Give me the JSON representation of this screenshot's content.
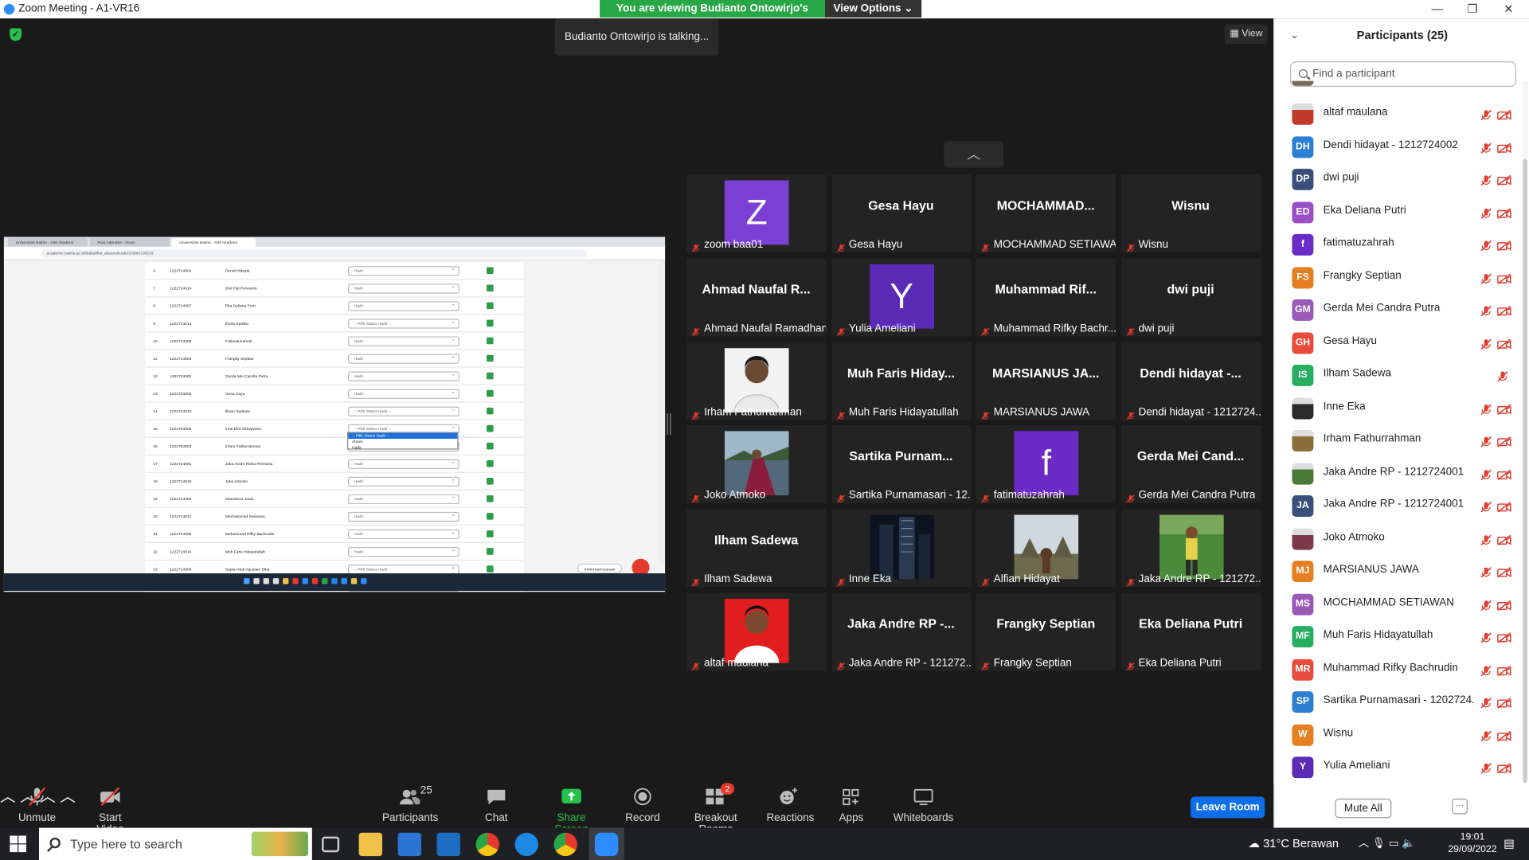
{
  "window": {
    "title": "Zoom Meeting - A1-VR16",
    "minimize": "—",
    "restore": "❐",
    "close": "✕"
  },
  "share_banner": {
    "text": "You are viewing Budianto Ontowirjo's screen",
    "view_options": "View Options ⌄"
  },
  "talking_indicator": "Budianto Ontowirjo is talking...",
  "view_button": "View",
  "gallery": [
    {
      "big": "",
      "avatar_letter": "Z",
      "avatar_color": "#7b3fd4",
      "name": "zoom baa01"
    },
    {
      "big": "Gesa Hayu",
      "name": "Gesa Hayu"
    },
    {
      "big": "MOCHAMMAD...",
      "name": "MOCHAMMAD SETIAWA..."
    },
    {
      "big": "Wisnu",
      "name": "Wisnu"
    },
    {
      "big": "Ahmad Naufal R...",
      "name": "Ahmad Naufal Ramadhan"
    },
    {
      "big": "",
      "avatar_letter": "Y",
      "avatar_color": "#5b2bb8",
      "name": "Yulia Ameliani"
    },
    {
      "big": "Muhammad Rif...",
      "name": "Muhammad Rifky Bachr..."
    },
    {
      "big": "dwi puji",
      "name": "dwi puji"
    },
    {
      "big": "",
      "photo": "person-white",
      "name": "Irham Fathurrahman"
    },
    {
      "big": "Muh Faris Hiday...",
      "name": "Muh Faris Hidayatullah"
    },
    {
      "big": "MARSIANUS JA...",
      "name": "MARSIANUS JAWA"
    },
    {
      "big": "Dendi hidayat -...",
      "name": "Dendi hidayat - 1212724..."
    },
    {
      "big": "",
      "photo": "landscape-scarf",
      "name": "Joko Atmoko"
    },
    {
      "big": "Sartika Purnam...",
      "name": "Sartika Purnamasari - 12..."
    },
    {
      "big": "",
      "avatar_letter": "f",
      "avatar_color": "#6a2bc7",
      "name": "fatimatuzahrah"
    },
    {
      "big": "Gerda Mei Cand...",
      "name": "Gerda Mei Candra Putra"
    },
    {
      "big": "Ilham Sadewa",
      "name": "Ilham Sadewa"
    },
    {
      "big": "",
      "photo": "city-night",
      "name": "Inne Eka"
    },
    {
      "big": "",
      "photo": "temple",
      "name": "Alfian Hidayat"
    },
    {
      "big": "",
      "photo": "football",
      "name": "Jaka Andre RP - 121272..."
    },
    {
      "big": "",
      "photo": "person-red",
      "name": "altaf maulana"
    },
    {
      "big": "Jaka Andre RP -...",
      "name": "Jaka Andre RP - 121272..."
    },
    {
      "big": "Frangky Septian",
      "name": "Frangky Septian"
    },
    {
      "big": "Eka Deliana Putri",
      "name": "Eka Deliana Putri"
    }
  ],
  "participants": {
    "title": "Participants (25)",
    "search_placeholder": "Find a participant",
    "list": [
      {
        "initials": "",
        "color": "#c0392b",
        "photo": true,
        "name": "altaf maulana",
        "cam": true
      },
      {
        "initials": "DH",
        "color": "#2d7fd3",
        "name": "Dendi hidayat - 1212724002",
        "cam": true
      },
      {
        "initials": "DP",
        "color": "#3a4f7a",
        "name": "dwi puji",
        "cam": true
      },
      {
        "initials": "ED",
        "color": "#9b4fc7",
        "name": "Eka Deliana Putri",
        "cam": true
      },
      {
        "initials": "f",
        "color": "#6a2bc7",
        "name": "fatimatuzahrah",
        "cam": true
      },
      {
        "initials": "FS",
        "color": "#e67e22",
        "name": "Frangky Septian",
        "cam": true
      },
      {
        "initials": "GM",
        "color": "#9b59b6",
        "name": "Gerda Mei Candra Putra",
        "cam": true
      },
      {
        "initials": "GH",
        "color": "#e74c3c",
        "name": "Gesa Hayu",
        "cam": true
      },
      {
        "initials": "IS",
        "color": "#27ae60",
        "name": "Ilham Sadewa",
        "cam": false
      },
      {
        "initials": "",
        "color": "#2b2b2b",
        "photo": true,
        "name": "Inne Eka",
        "cam": true
      },
      {
        "initials": "",
        "color": "#8a6d3b",
        "photo": true,
        "name": "Irham Fathurrahman",
        "cam": true
      },
      {
        "initials": "",
        "color": "#4a7a3a",
        "photo": true,
        "name": "Jaka Andre RP - 1212724001",
        "cam": true
      },
      {
        "initials": "JA",
        "color": "#3a4f7a",
        "name": "Jaka Andre RP - 1212724001",
        "cam": true
      },
      {
        "initials": "",
        "color": "#7a3a4a",
        "photo": true,
        "name": "Joko Atmoko",
        "cam": true
      },
      {
        "initials": "MJ",
        "color": "#e67e22",
        "name": "MARSIANUS JAWA",
        "cam": true
      },
      {
        "initials": "MS",
        "color": "#9b59b6",
        "name": "MOCHAMMAD SETIAWAN",
        "cam": true
      },
      {
        "initials": "MF",
        "color": "#27ae60",
        "name": "Muh Faris Hidayatullah",
        "cam": true
      },
      {
        "initials": "MR",
        "color": "#e74c3c",
        "name": "Muhammad Rifky Bachrudin",
        "cam": true
      },
      {
        "initials": "SP",
        "color": "#2d7fd3",
        "name": "Sartika Purnamasari - 1202724...",
        "cam": true
      },
      {
        "initials": "W",
        "color": "#e67e22",
        "name": "Wisnu",
        "cam": true
      },
      {
        "initials": "Y",
        "color": "#5b2bb8",
        "name": "Yulia Ameliani",
        "cam": true
      }
    ],
    "mute_all": "Mute All",
    "more": "···"
  },
  "toolbar": {
    "unmute": "Unmute",
    "start_video": "Start Video",
    "participants": "Participants",
    "participant_count": "25",
    "chat": "Chat",
    "share_screen": "Share Screen",
    "record": "Record",
    "breakout_rooms": "Breakout Rooms",
    "breakout_badge": "2",
    "reactions": "Reactions",
    "apps": "Apps",
    "whiteboards": "Whiteboards",
    "leave": "Leave Room"
  },
  "shared_screen": {
    "tabs": [
      "Universitas Bakrie - SIM Akademi",
      "Post Attendee - Zoom",
      "Universitas Bakrie - SIM Akademi"
    ],
    "url": "academic.bakrie.ac.id/bakad/list_absensi/code/32888/100233",
    "rows": [
      {
        "no": "6",
        "nim": "1222714002",
        "name": "Dendi Hidayat",
        "status": "Hadir"
      },
      {
        "no": "7",
        "nim": "1222714014",
        "name": "Dwi Puji Purwanto",
        "status": "Hadir"
      },
      {
        "no": "8",
        "nim": "1222714007",
        "name": "Eka Deliana Putri",
        "status": "Hadir"
      },
      {
        "no": "9",
        "nim": "1222714013",
        "name": "Elvira Kartika",
        "status": "-- Pilih Status Hadir --"
      },
      {
        "no": "10",
        "nim": "1222714008",
        "name": "Fatimatuzahrah",
        "status": "Hadir"
      },
      {
        "no": "11",
        "nim": "1222714003",
        "name": "Frangky Septian",
        "status": "Hadir"
      },
      {
        "no": "12",
        "nim": "1202724002",
        "name": "Gerda Mei Candra Putra",
        "status": "Hadir"
      },
      {
        "no": "13",
        "nim": "1222704006",
        "name": "Gesa Hayu",
        "status": "Hadir"
      },
      {
        "no": "14",
        "nim": "1222714010",
        "name": "Ilham Sadewa",
        "status": "-- Pilih Status Hadir --"
      },
      {
        "no": "15",
        "nim": "1222704005",
        "name": "Inne Eka Oktaviyanti",
        "status": "-- Pilih Status Hadir --"
      },
      {
        "no": "16",
        "nim": "1222704003",
        "name": "Irham Fathurrahman",
        "status": ""
      },
      {
        "no": "17",
        "nim": "1222724001",
        "name": "Jaka Andre Rizka Permana",
        "status": "Hadir"
      },
      {
        "no": "18",
        "nim": "1222714010",
        "name": "Joko Atmoko",
        "status": "Hadir"
      },
      {
        "no": "19",
        "nim": "1222714009",
        "name": "Marsianus Jawa",
        "status": "Hadir"
      },
      {
        "no": "20",
        "nim": "1222714012",
        "name": "Mochammad Setiawan",
        "status": "Hadir"
      },
      {
        "no": "21",
        "nim": "1222714005",
        "name": "Muhammad Rifky Bachrudin",
        "status": "Hadir"
      },
      {
        "no": "22",
        "nim": "1222714016",
        "name": "Muh Faris Hidayatullah",
        "status": "Hadir"
      },
      {
        "no": "23",
        "nim": "1222714006",
        "name": "Sapta Hadi Agustian Dika",
        "status": "-- Pilih Status Hadir --"
      },
      {
        "no": "24",
        "nim": "1202704001",
        "name": "Sartika Purnamasari",
        "status": "Hadir"
      }
    ],
    "dropdown_options": [
      "-- Pilih Status Hadir --",
      "Absen",
      "Hadir"
    ],
    "chat_prompt": "Kirimi kami pesan"
  },
  "win_taskbar": {
    "search_placeholder": "Type here to search",
    "weather": "31°C  Berawan",
    "time": "19:01",
    "date": "29/09/2022"
  }
}
